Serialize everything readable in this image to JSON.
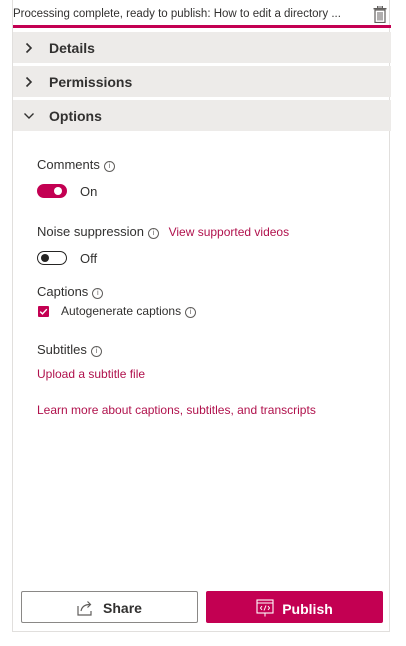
{
  "status": {
    "text": "Processing complete, ready to publish: How to edit a directory ..."
  },
  "icons": {
    "delete": "trash-icon",
    "info": "info-icon",
    "share": "share-icon",
    "publish": "publish-icon"
  },
  "sections": {
    "details": {
      "label": "Details",
      "expanded": false
    },
    "permissions": {
      "label": "Permissions",
      "expanded": false
    },
    "options": {
      "label": "Options",
      "expanded": true
    }
  },
  "options": {
    "comments": {
      "label": "Comments",
      "info": "i",
      "toggle_state": "On",
      "enabled": true
    },
    "noise": {
      "label": "Noise suppression",
      "info": "i",
      "link": "View supported videos",
      "toggle_state": "Off",
      "enabled": false
    },
    "captions": {
      "label": "Captions",
      "info": "i",
      "checkbox_label": "Autogenerate captions",
      "checkbox_info": "i",
      "checked": true
    },
    "subtitles": {
      "label": "Subtitles",
      "info": "i",
      "link": "Upload a subtitle file"
    },
    "learn_more": "Learn more about captions, subtitles, and transcripts"
  },
  "actions": {
    "share_label": "Share",
    "publish_label": "Publish"
  },
  "colors": {
    "accent": "#c30052",
    "section_bg": "#edebe9"
  }
}
